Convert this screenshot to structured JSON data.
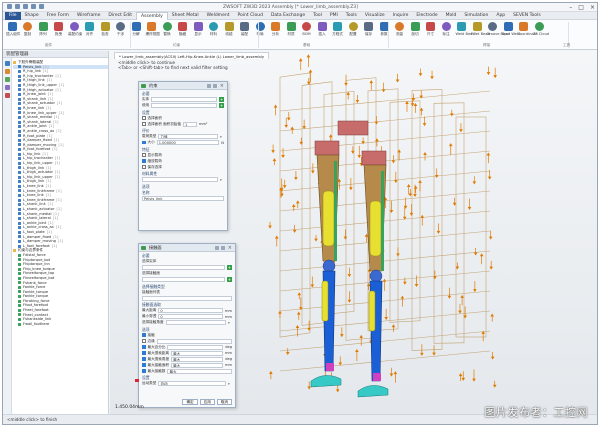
{
  "window": {
    "title": "ZWSOFT ZW3D 2023   Assembly   [* Lower_limb_assembly.Z3]"
  },
  "menubar": {
    "tabs": [
      "File",
      "Shape",
      "Free Form",
      "Wireframe",
      "Direct Edit",
      "Assembly",
      "Sheet Metal",
      "Weldment",
      "Point Cloud",
      "Data Exchange",
      "Tool",
      "PMI",
      "Tools",
      "Visualize",
      "Inquire",
      "Electrode",
      "Mold",
      "Simulation",
      "App",
      "SEVEN Tools"
    ]
  },
  "ribbon": {
    "buttons": [
      "插入组件",
      "复制",
      "阵列",
      "拖曳",
      "装配约束",
      "对齐",
      "检查",
      "干涉",
      "分解",
      "爆炸视图",
      "替换",
      "隐藏",
      "显示",
      "材料",
      "线缆",
      "装配",
      "布局",
      "分析",
      "材质",
      "BOM",
      "插入",
      "方程式",
      "配置",
      "保存",
      "参数",
      "测量",
      "剖切",
      "尺寸",
      "标注",
      "Weld Bead",
      "Fillet Bead",
      "Groove Bead",
      "Spot Weld",
      "Coordinate",
      "Z3 Cloud"
    ],
    "groups": [
      "组件",
      "约束",
      "基础",
      "焊接",
      "工具"
    ]
  },
  "left_panel": {
    "header": "装配管理器",
    "tree": [
      {
        "label": "下肢外骨骼装配",
        "tag": "",
        "kind": "group"
      },
      {
        "label": "Pelvis_link",
        "tag": "[1]"
      },
      {
        "label": "R_hip_link",
        "tag": "[1]"
      },
      {
        "label": "R_hip_trochanter",
        "tag": "[1]"
      },
      {
        "label": "R_thigh_link",
        "tag": "[1]"
      },
      {
        "label": "R_thigh_link_upper",
        "tag": "[1]"
      },
      {
        "label": "R_thigh_actuator",
        "tag": "[1]"
      },
      {
        "label": "R_knee_joint",
        "tag": "[1]"
      },
      {
        "label": "R_shank_link",
        "tag": "[1]"
      },
      {
        "label": "R_shank_actuator",
        "tag": "[1]"
      },
      {
        "label": "R_knee_link",
        "tag": "[1]"
      },
      {
        "label": "R_knee_link_upper",
        "tag": "[1]"
      },
      {
        "label": "R_shank_medial",
        "tag": "[1]"
      },
      {
        "label": "R_shank_lateral",
        "tag": "[1]"
      },
      {
        "label": "R_ankle_joint",
        "tag": "[1]"
      },
      {
        "label": "R_ankle_cross_ax",
        "tag": "[1]"
      },
      {
        "label": "R_foot_plate",
        "tag": "[1]"
      },
      {
        "label": "R_damper_fixed",
        "tag": "[1]"
      },
      {
        "label": "R_damper_moving",
        "tag": "[1]"
      },
      {
        "label": "R_foot_forefoot",
        "tag": "[1]"
      },
      {
        "label": "L_hip_link",
        "tag": "[1]"
      },
      {
        "label": "L_hip_trochanter",
        "tag": "[1]"
      },
      {
        "label": "L_hip_link_upper",
        "tag": "[1]"
      },
      {
        "label": "L_thigh_link",
        "tag": "[1]"
      },
      {
        "label": "L_thigh_actuator",
        "tag": "[1]"
      },
      {
        "label": "L_hip_link_upper",
        "tag": "[1]"
      },
      {
        "label": "L_thigh_link",
        "tag": "[1]"
      },
      {
        "label": "L_knee_link",
        "tag": "[1]"
      },
      {
        "label": "L_knee_linkframe",
        "tag": "[1]"
      },
      {
        "label": "L_knee_link",
        "tag": "[1]"
      },
      {
        "label": "L_knee_linkframe",
        "tag": "[1]"
      },
      {
        "label": "L_shank_link",
        "tag": "[1]"
      },
      {
        "label": "L_shank_actuator",
        "tag": "[1]"
      },
      {
        "label": "L_shank_medial",
        "tag": "[1]"
      },
      {
        "label": "L_shank_lateral",
        "tag": "[1]"
      },
      {
        "label": "L_ankle_joint",
        "tag": "[1]"
      },
      {
        "label": "L_ankle_cross_ax",
        "tag": "[1]"
      },
      {
        "label": "L_foot_plate",
        "tag": "[1]"
      },
      {
        "label": "L_damper_fixed",
        "tag": "[1]"
      },
      {
        "label": "L_damper_moving",
        "tag": "[1]"
      },
      {
        "label": "L_foot_forefoot",
        "tag": "[1]"
      },
      {
        "label": "约束与边界条件",
        "tag": "",
        "kind": "group"
      },
      {
        "label": "Fdistal_force",
        "tag": "",
        "kind": "g2"
      },
      {
        "label": "Fhiptorque_bot",
        "tag": "",
        "kind": "g2"
      },
      {
        "label": "Fhiptorque_inn",
        "tag": "",
        "kind": "g2"
      },
      {
        "label": "Fhip_knee_torque",
        "tag": "",
        "kind": "g2"
      },
      {
        "label": "Fkneeltorque_top",
        "tag": "",
        "kind": "g2"
      },
      {
        "label": "Fkneeltorque_bot",
        "tag": "",
        "kind": "g2"
      },
      {
        "label": "Fshank_force",
        "tag": "",
        "kind": "g2"
      },
      {
        "label": "Fankle_force",
        "tag": "",
        "kind": "g2"
      },
      {
        "label": "Fankle_torque",
        "tag": "",
        "kind": "g2"
      },
      {
        "label": "Fankle_torque",
        "tag": "",
        "kind": "g2"
      },
      {
        "label": "Fbraking_force",
        "tag": "",
        "kind": "g2"
      },
      {
        "label": "Ffoot_forefoot",
        "tag": "",
        "kind": "g2"
      },
      {
        "label": "Fheel_forefoot",
        "tag": "",
        "kind": "g2"
      },
      {
        "label": "Fheel_contact",
        "tag": "",
        "kind": "g2"
      },
      {
        "label": "Fshankside_link",
        "tag": "",
        "kind": "g2"
      },
      {
        "label": "Fwall_foothere",
        "tag": "",
        "kind": "g2"
      }
    ]
  },
  "viewport": {
    "tab": "* Lower_limb_assembly(ACSII) Left-Hip-Knee-Ankle (L)  Lower_limb_assembly",
    "hint1": "<middle click> to continue",
    "hint2": "<Tab> or <Shift-tab> to find next valid filter setting"
  },
  "dialog1": {
    "title": "约束",
    "sections": [
      "必要",
      "设置",
      "评价",
      "特征",
      "材料属性",
      "选项",
      "名称"
    ],
    "fields": {
      "entity_label": "实体",
      "entity_value": "",
      "use_label": "使用",
      "area_label": "面积",
      "area_value": "1",
      "area_unit": "mm²",
      "cb1": "选择面积",
      "cb2": "选择面积  面积初始值",
      "type_label": "载荷类型",
      "type_value": "力值",
      "mag_label": "大小",
      "mag_value": "1.000000",
      "mag_unit": "N",
      "opt1": "显示载荷",
      "opt2": "缩放载荷",
      "opt3": "保存选择",
      "name_value": "Pelvis_link"
    }
  },
  "dialog2": {
    "title": "接触面",
    "sections": [
      "必要",
      "选择接触类型",
      "接触面选取",
      "选项",
      "设置"
    ],
    "fields": {
      "a": "选择实体",
      "b": "选择接触面",
      "c": "接触面列表",
      "d": "最大距离",
      "d_val": "0",
      "e": "最小穿透",
      "e_val": "0",
      "f": "选择接触角度",
      "g": "最大百分比",
      "h": "最大搜索距离",
      "h_val": "最大",
      "i": "最大搜索角度",
      "i_val": "最大",
      "j": "最大接触面积",
      "j_val": "最大",
      "k": "最大接触数",
      "k_val": "最大",
      "unit": "mm",
      "deg": "deg",
      "opt_label": "运动类型",
      "opt_value": "自动",
      "cb_a": "接触",
      "cb_b": "边缘",
      "foot_ok": "确定",
      "foot_apply": "应用",
      "foot_cancel": "取消"
    }
  },
  "statusbar": {
    "text": "<middle click> to finish",
    "coord": "1.450.04mm"
  },
  "watermark": "图片发布者：工控网",
  "colors": {
    "accent": "#2b5797",
    "arrow": "#e07b00",
    "actuator": "#e8e030",
    "link_blue": "#1b5fd6",
    "frame_brown": "#b58a4a"
  }
}
